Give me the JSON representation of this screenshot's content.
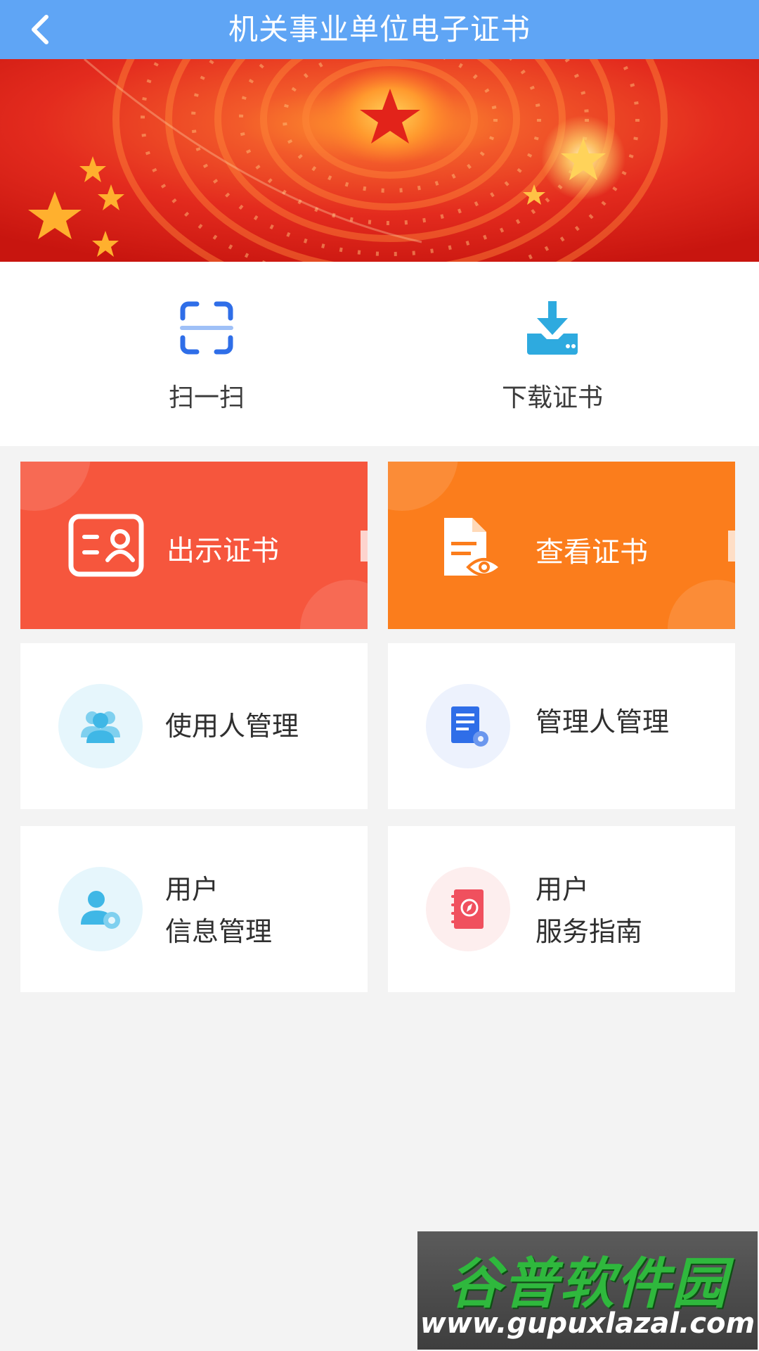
{
  "header": {
    "title": "机关事业单位电子证书",
    "back_icon": "chevron-left-icon",
    "bar_color": "#5fa5f5"
  },
  "quick_actions": [
    {
      "label": "扫一扫",
      "icon": "scan-icon"
    },
    {
      "label": "下载证书",
      "icon": "download-icon"
    }
  ],
  "primary_cards": [
    {
      "label": "出示证书",
      "icon": "id-card-icon",
      "color": "#f6563d"
    },
    {
      "label": "查看证书",
      "icon": "view-document-icon",
      "color": "#fb7d1c"
    }
  ],
  "menu_cards": [
    {
      "lines": [
        "使用人管理"
      ],
      "icon": "users-icon",
      "icon_bg": "#e6f6fc"
    },
    {
      "lines": [
        "管理人管理"
      ],
      "icon": "admin-document-icon",
      "icon_bg": "#edf2fd"
    },
    {
      "lines": [
        "用户",
        "信息管理"
      ],
      "icon": "user-settings-icon",
      "icon_bg": "#e6f6fc"
    },
    {
      "lines": [
        "用户",
        "服务指南"
      ],
      "icon": "guide-book-icon",
      "icon_bg": "#fdeeee"
    }
  ],
  "watermark": {
    "brand": "谷普软件园",
    "url": "www.gupuxlazal.com"
  }
}
